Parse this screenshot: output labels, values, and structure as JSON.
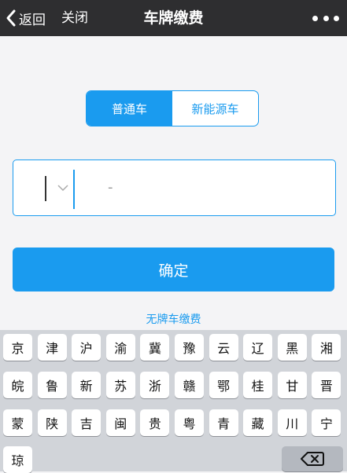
{
  "topbar": {
    "back_label": "返回",
    "close_label": "关闭",
    "title": "车牌缴费"
  },
  "tabs": [
    {
      "label": "普通车",
      "active": true
    },
    {
      "label": "新能源车",
      "active": false
    }
  ],
  "plate_input": {
    "separator": "-"
  },
  "confirm_label": "确定",
  "no_plate_link": "无牌车缴费",
  "keyboard": {
    "rows": [
      [
        "京",
        "津",
        "沪",
        "渝",
        "冀",
        "豫",
        "云",
        "辽",
        "黑",
        "湘"
      ],
      [
        "皖",
        "鲁",
        "新",
        "苏",
        "浙",
        "赣",
        "鄂",
        "桂",
        "甘",
        "晋"
      ],
      [
        "蒙",
        "陕",
        "吉",
        "闽",
        "贵",
        "粤",
        "青",
        "藏",
        "川",
        "宁"
      ],
      [
        "琼"
      ]
    ],
    "delete_icon": "backspace-icon"
  },
  "colors": {
    "accent": "#1a9bef",
    "topbar": "#2e2e30",
    "keyboard_bg": "#d1d4d9"
  }
}
